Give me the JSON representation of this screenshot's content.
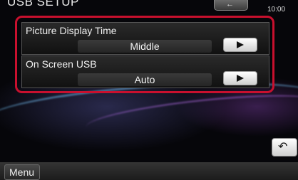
{
  "header": {
    "title": "USB SETUP",
    "clock": "10:00"
  },
  "settings": [
    {
      "label": "Picture Display Time",
      "value": "Middle"
    },
    {
      "label": "On Screen USB",
      "value": "Auto"
    }
  ],
  "footer": {
    "menu_label": "Menu"
  },
  "icons": {
    "back_top": "back-arrow-icon",
    "return": "return-arrow-icon",
    "next": "play-arrow-icon"
  },
  "colors": {
    "highlight": "#c8102e"
  }
}
